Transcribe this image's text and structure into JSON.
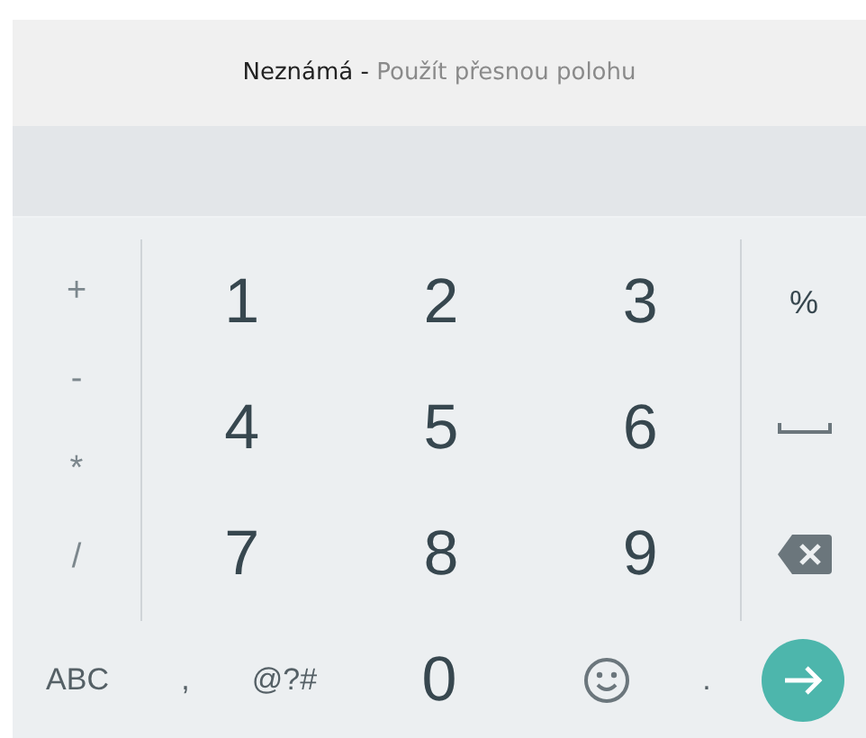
{
  "location_bar": {
    "location": "Neznámá -",
    "action": "Použít přesnou polohu"
  },
  "keyboard": {
    "symbol_keys": [
      "+",
      "-",
      "*",
      "/"
    ],
    "digit_keys": [
      "1",
      "2",
      "3",
      "4",
      "5",
      "6",
      "7",
      "8",
      "9"
    ],
    "side_keys": [
      {
        "kind": "text",
        "label": "%"
      },
      {
        "kind": "space"
      },
      {
        "kind": "backspace"
      }
    ],
    "bottom_keys": [
      {
        "kind": "text",
        "label": "ABC"
      },
      {
        "kind": "text",
        "label": ","
      },
      {
        "kind": "text",
        "label": "@?#"
      },
      {
        "kind": "digit",
        "label": "0"
      },
      {
        "kind": "emoji"
      },
      {
        "kind": "text",
        "label": "."
      },
      {
        "kind": "enter"
      }
    ]
  }
}
